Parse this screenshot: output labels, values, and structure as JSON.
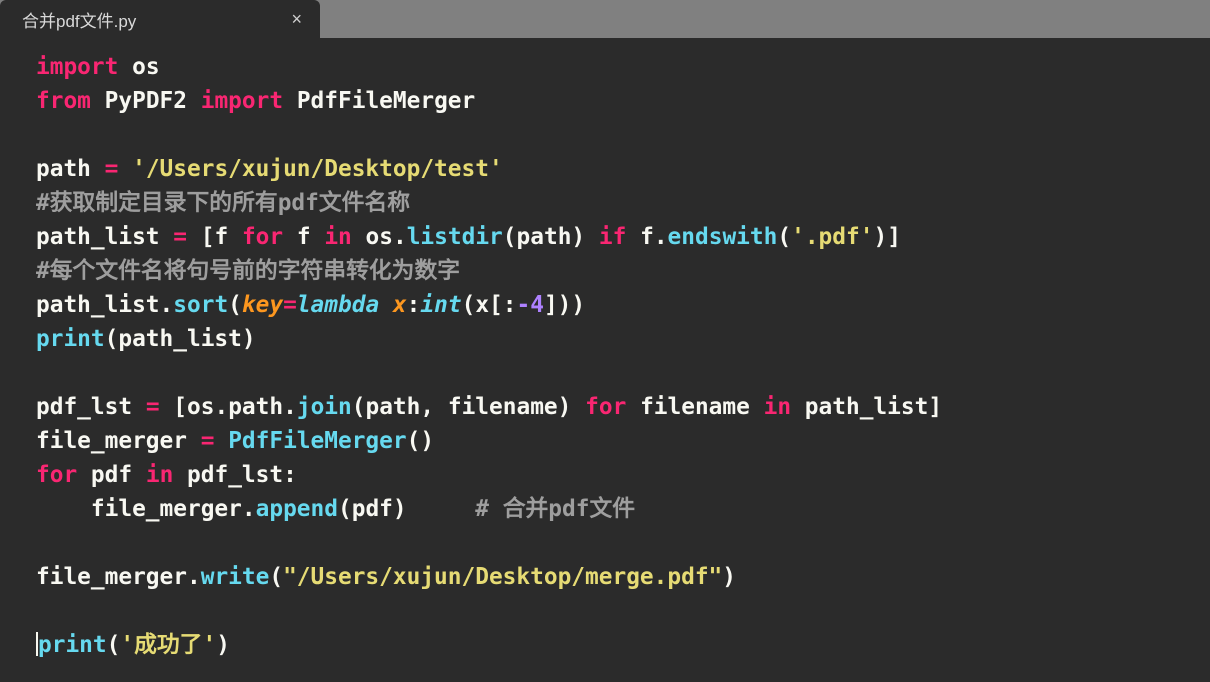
{
  "tab": {
    "title": "合并pdf文件.py",
    "close_glyph": "×"
  },
  "code": {
    "l1": {
      "import": "import",
      "os": "os"
    },
    "l2": {
      "from": "from",
      "pkg": "PyPDF2",
      "import": "import",
      "cls": "PdfFileMerger"
    },
    "l4": {
      "path": "path",
      "eq": "=",
      "str": "'/Users/xujun/Desktop/test'"
    },
    "l5": {
      "cmt": "#获取制定目录下的所有pdf文件名称"
    },
    "l6": {
      "path_list": "path_list",
      "eq": "=",
      "ob": "[",
      "f1": "f",
      "for": "for",
      "f2": "f",
      "in": "in",
      "os": "os",
      "dot1": ".",
      "listdir": "listdir",
      "op": "(",
      "arg": "path",
      "cp": ")",
      "if": "if",
      "f3": "f",
      "dot2": ".",
      "endswith": "endswith",
      "op2": "(",
      "pdfstr": "'.pdf'",
      "cp2": ")",
      "cb": "]"
    },
    "l7": {
      "cmt": "#每个文件名将句号前的字符串转化为数字"
    },
    "l8": {
      "path_list": "path_list",
      "dot": ".",
      "sort": "sort",
      "op": "(",
      "key": "key",
      "eq": "=",
      "lambda": "lambda",
      "x": "x",
      "colon": ":",
      "int": "int",
      "op2": "(",
      "xs": "x[:",
      "neg4": "-4",
      "close": "])",
      "cp": ")"
    },
    "l9": {
      "print": "print",
      "op": "(",
      "arg": "path_list",
      "cp": ")"
    },
    "l11": {
      "pdf_lst": "pdf_lst",
      "eq": "=",
      "ob": "[",
      "os": "os",
      "dot1": ".",
      "path": "path",
      "dot2": ".",
      "join": "join",
      "op": "(",
      "a1": "path",
      "comma": ",",
      "a2": "filename",
      "cp": ")",
      "for": "for",
      "fn": "filename",
      "in": "in",
      "pl": "path_list",
      "cb": "]"
    },
    "l12": {
      "file_merger": "file_merger",
      "eq": "=",
      "cls": "PdfFileMerger",
      "op": "(",
      "cp": ")"
    },
    "l13": {
      "for": "for",
      "pdf": "pdf",
      "in": "in",
      "pdf_lst": "pdf_lst",
      "colon": ":"
    },
    "l14": {
      "indent": "    ",
      "file_merger": "file_merger",
      "dot": ".",
      "append": "append",
      "op": "(",
      "arg": "pdf",
      "cp": ")",
      "spaces": "     ",
      "cmt": "# 合并pdf文件"
    },
    "l16": {
      "file_merger": "file_merger",
      "dot": ".",
      "write": "write",
      "op": "(",
      "str": "\"/Users/xujun/Desktop/merge.pdf\"",
      "cp": ")"
    },
    "l18": {
      "print": "print",
      "op": "(",
      "str": "'成功了'",
      "cp": ")"
    }
  }
}
